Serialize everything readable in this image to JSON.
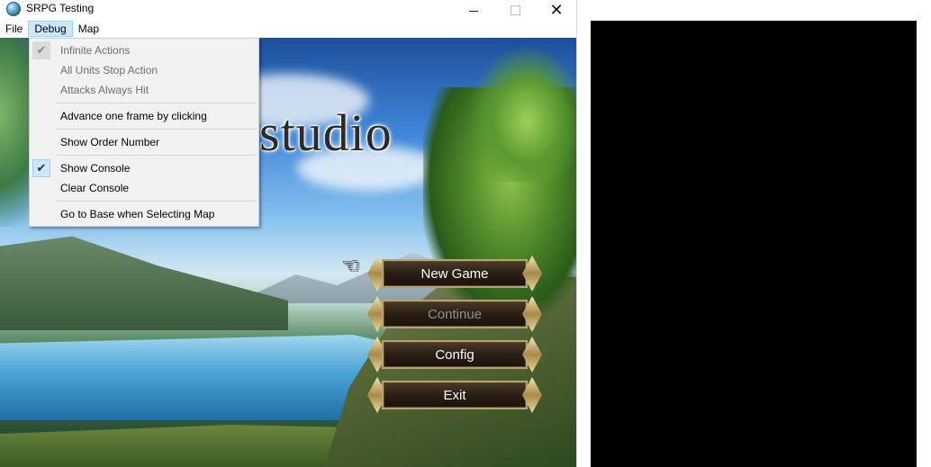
{
  "window": {
    "title": "SRPG Testing"
  },
  "menubar": {
    "items": [
      "File",
      "Debug",
      "Map"
    ]
  },
  "debug_menu": {
    "items": [
      {
        "label": "Infinite Actions",
        "checked": true,
        "enabled": false
      },
      {
        "label": "All Units Stop Action",
        "checked": false,
        "enabled": false
      },
      {
        "label": "Attacks Always Hit",
        "checked": false,
        "enabled": false
      },
      {
        "label": "Advance one frame by clicking",
        "checked": false,
        "enabled": true
      },
      {
        "label": "Show Order Number",
        "checked": false,
        "enabled": true
      },
      {
        "label": "Show Console",
        "checked": true,
        "enabled": true
      },
      {
        "label": "Clear Console",
        "checked": false,
        "enabled": true
      },
      {
        "label": "Go to Base when Selecting Map",
        "checked": false,
        "enabled": true
      }
    ]
  },
  "game": {
    "logo_text": "studio",
    "buttons": [
      {
        "label": "New Game",
        "enabled": true,
        "selected": true
      },
      {
        "label": "Continue",
        "enabled": false,
        "selected": false
      },
      {
        "label": "Config",
        "enabled": true,
        "selected": false
      },
      {
        "label": "Exit",
        "enabled": true,
        "selected": false
      }
    ]
  },
  "colors": {
    "menu_highlight": "#cce8ff",
    "menu_highlight_border": "#99d1ff",
    "console_background": "#000000"
  },
  "icons": {
    "app": "globe-icon",
    "check": "check-icon",
    "pointer": "hand-pointer-icon"
  }
}
